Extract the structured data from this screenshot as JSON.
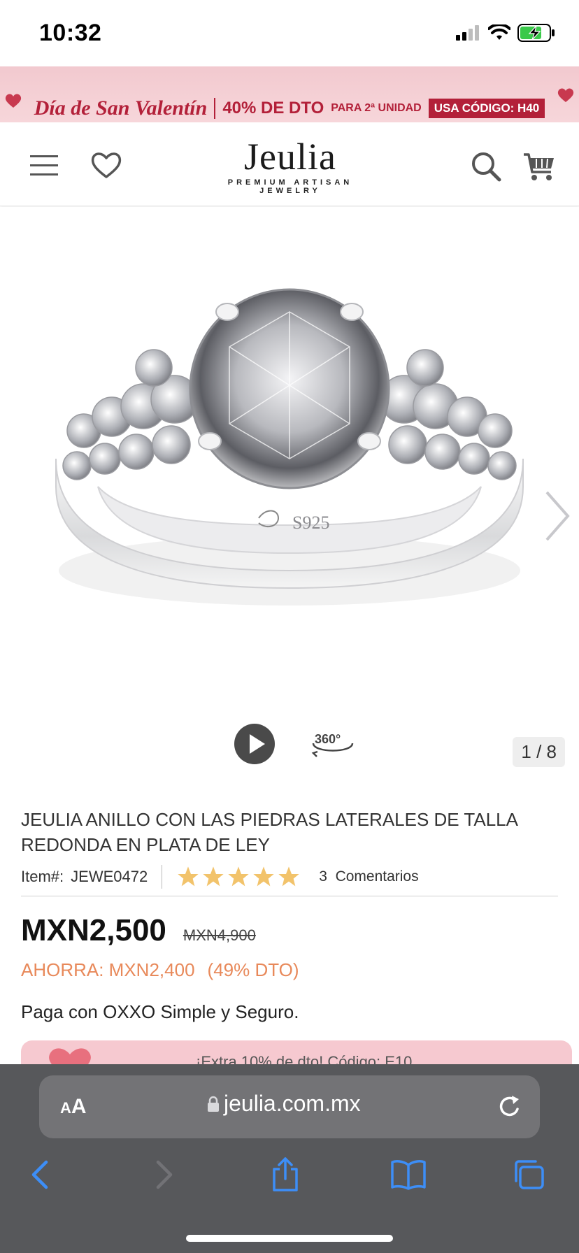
{
  "status_bar": {
    "time": "10:32"
  },
  "promo": {
    "script": "Día de San Valentín",
    "offer": "40% DE DTO",
    "small": "PARA 2ª UNIDAD",
    "code": "USA CÓDIGO: H40"
  },
  "header": {
    "logo_word": "Jeulia",
    "logo_tagline": "PREMIUM  ARTISAN  JEWELRY",
    "icons": [
      "menu-icon",
      "heart-icon",
      "search-icon",
      "cart-icon"
    ]
  },
  "gallery": {
    "engraving": "S925",
    "counter": "1 / 8",
    "controls": [
      "play-icon",
      "rotate-360-icon"
    ],
    "label_360": "360°"
  },
  "product": {
    "title": "JEULIA ANILLO CON LAS PIEDRAS LATERALES DE TALLA REDONDA EN PLATA DE LEY",
    "item_label": "Item#:",
    "item_code": "JEWE0472",
    "rating": 5,
    "reviews_count": "3",
    "reviews_label": "Comentarios",
    "price_now": "MXN2,500",
    "price_old": "MXN4,900",
    "savings": "AHORRA: MXN2,400",
    "discount": "(49% DTO)",
    "pay_note": "Paga con OXXO Simple y Seguro.",
    "coupon": "¡Extra 10% de dto! Código: E10"
  },
  "safari": {
    "aa_small": "A",
    "aa_big": "A",
    "url": "jeulia.com.mx"
  },
  "colors": {
    "accent_red": "#b32039",
    "promo_bg": "#f2c9cf",
    "savings_orange": "#e8895a",
    "star_gold": "#f2c36b",
    "safari_bg": "#57585b",
    "ios_blue": "#3d8ef7"
  }
}
